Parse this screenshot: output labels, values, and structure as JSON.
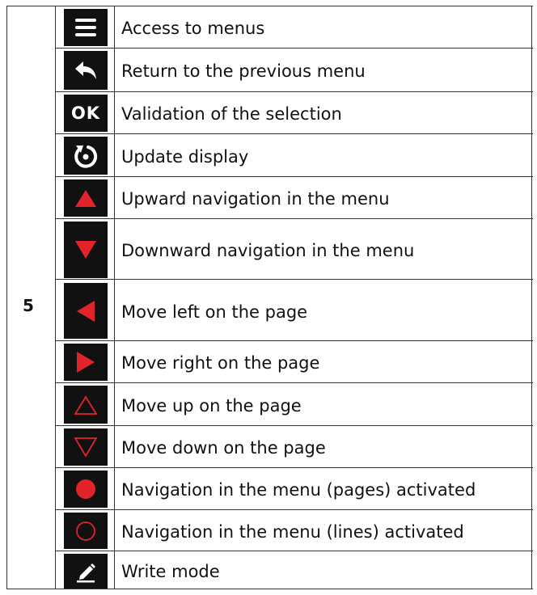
{
  "section_number": "5",
  "rows": [
    {
      "icon": "menu-icon",
      "label": "Access to menus"
    },
    {
      "icon": "return-arrow-icon",
      "label": "Return to the previous menu"
    },
    {
      "icon": "ok-icon",
      "label": "Validation of the selection"
    },
    {
      "icon": "refresh-icon",
      "label": "Update display"
    },
    {
      "icon": "red-up-triangle-icon",
      "label": "Upward navigation in the menu"
    },
    {
      "icon": "red-down-triangle-icon",
      "label": "Downward navigation in the menu"
    },
    {
      "icon": "red-left-triangle-icon",
      "label": "Move left on the page"
    },
    {
      "icon": "red-right-triangle-icon",
      "label": "Move right on the page"
    },
    {
      "icon": "red-up-triangle-outline-icon",
      "label": "Move up on the page"
    },
    {
      "icon": "red-down-triangle-outline-icon",
      "label": "Move down on the page"
    },
    {
      "icon": "red-filled-circle-icon",
      "label": "Navigation in the menu (pages) activated"
    },
    {
      "icon": "red-circle-outline-icon",
      "label": "Navigation in the menu (lines) activated"
    },
    {
      "icon": "pencil-icon",
      "label": "Write mode"
    }
  ],
  "ok_icon_text": "OK",
  "colors": {
    "icon_bg": "#111111",
    "accent_red": "#e0242a",
    "border": "#333333"
  }
}
